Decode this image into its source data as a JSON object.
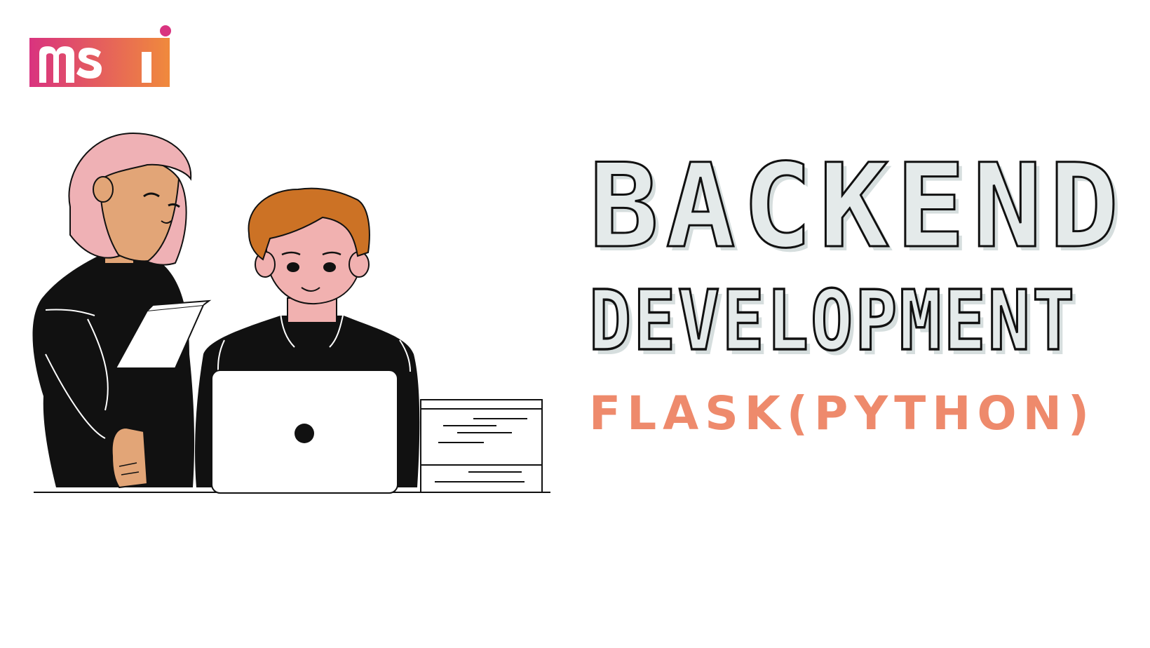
{
  "logo": {
    "text": "msi"
  },
  "headline": {
    "line1": "BACKEND",
    "line2": "DEVELOPMENT",
    "subtitle": "FLASK(PYTHON)"
  },
  "colors": {
    "background": "#ffffff",
    "title_fill": "#e4eaea",
    "title_outline": "#111111",
    "subtitle": "#ee8a6c",
    "logo_gradient_start": "#d9337f",
    "logo_gradient_end": "#f08a3c",
    "hair_pink": "#efb1b5",
    "skin_tan": "#e2a577",
    "hair_orange": "#cc7225",
    "skin_pink": "#f1b1b0",
    "clothing": "#111111"
  },
  "illustration": {
    "subject": "two-people-working-at-laptop-icon"
  }
}
